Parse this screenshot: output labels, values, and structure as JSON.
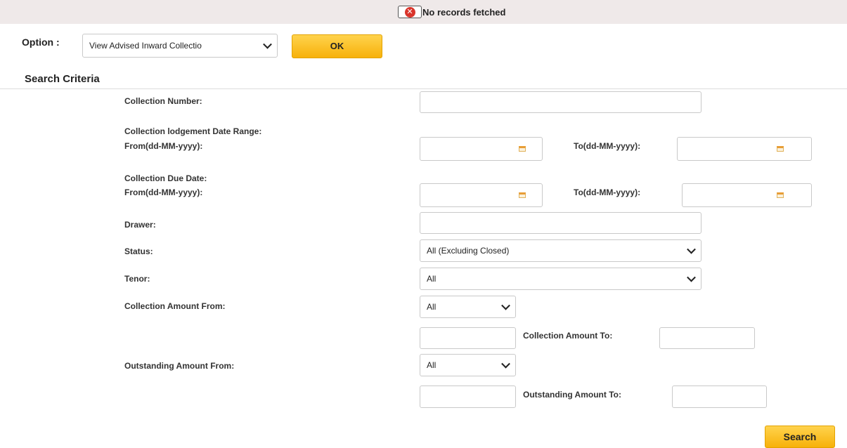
{
  "banner": {
    "icon": "error-icon",
    "glyph": "✕",
    "message": "No records fetched"
  },
  "option": {
    "label": "Option :",
    "selected": "View Advised Inward Collectio",
    "ok_label": "OK"
  },
  "section_title": "Search Criteria",
  "fields": {
    "collection_number": "Collection Number:",
    "lodgement_range": "Collection lodgement Date Range:",
    "lodgement_from": "From(dd-MM-yyyy):",
    "lodgement_to": "To(dd-MM-yyyy):",
    "due_date": "Collection Due Date:",
    "due_from": "From(dd-MM-yyyy):",
    "due_to": "To(dd-MM-yyyy):",
    "drawer": "Drawer:",
    "status": "Status:",
    "status_value": "All (Excluding Closed)",
    "tenor": "Tenor:",
    "tenor_value": "All",
    "coll_amount_from": "Collection Amount From:",
    "coll_amount_from_value": "All",
    "coll_amount_to": "Collection Amount To:",
    "out_amount_from": "Outstanding Amount From:",
    "out_amount_from_value": "All",
    "out_amount_to": "Outstanding Amount To:"
  },
  "search_label": "Search",
  "colors": {
    "accent": "#f7b10a",
    "error": "#d9342b",
    "banner_bg": "#efe9e9"
  }
}
